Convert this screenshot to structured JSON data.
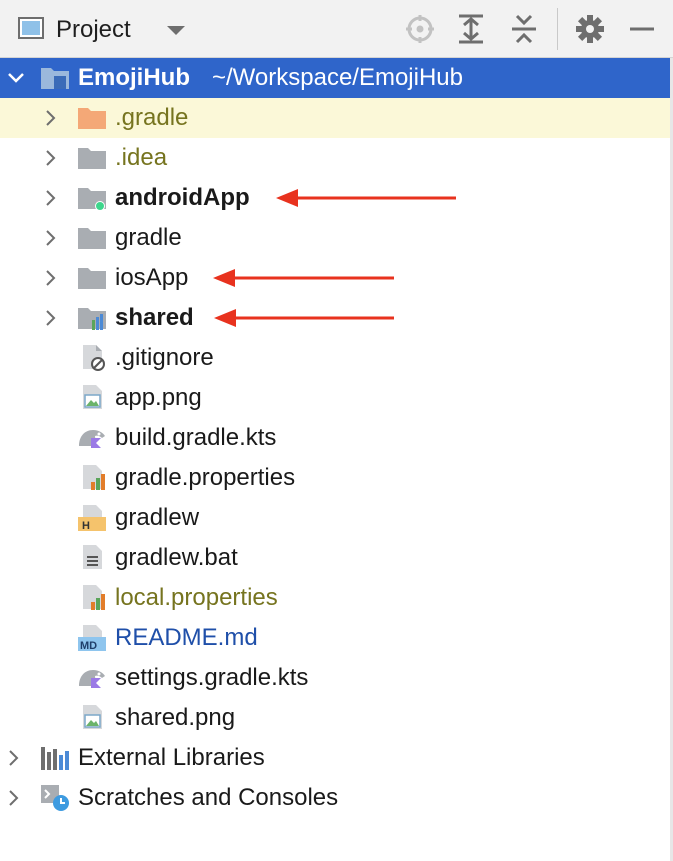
{
  "toolbar": {
    "title": "Project",
    "icons": [
      "project-view-icon",
      "dropdown-chevron-icon",
      "locate-target-icon",
      "expand-all-icon",
      "collapse-all-icon",
      "gear-icon",
      "minimize-icon"
    ]
  },
  "tree": {
    "root": {
      "name": "EmojiHub",
      "path": "~/Workspace/EmojiHub"
    },
    "children": [
      {
        "label": ".gradle",
        "icon": "folder-orange-icon"
      },
      {
        "label": ".idea",
        "icon": "folder-icon"
      },
      {
        "label": "androidApp",
        "icon": "android-module-folder-icon"
      },
      {
        "label": "gradle",
        "icon": "folder-icon"
      },
      {
        "label": "iosApp",
        "icon": "folder-icon"
      },
      {
        "label": "shared",
        "icon": "module-folder-icon"
      },
      {
        "label": ".gitignore",
        "icon": "gitignore-file-icon"
      },
      {
        "label": "app.png",
        "icon": "image-file-icon"
      },
      {
        "label": "build.gradle.kts",
        "icon": "gradle-kotlin-file-icon"
      },
      {
        "label": "gradle.properties",
        "icon": "properties-file-icon"
      },
      {
        "label": "gradlew",
        "icon": "shell-script-file-icon"
      },
      {
        "label": "gradlew.bat",
        "icon": "text-file-icon"
      },
      {
        "label": "local.properties",
        "icon": "properties-file-icon"
      },
      {
        "label": "README.md",
        "icon": "markdown-file-icon"
      },
      {
        "label": "settings.gradle.kts",
        "icon": "gradle-kotlin-file-icon"
      },
      {
        "label": "shared.png",
        "icon": "image-file-icon"
      }
    ],
    "external_libraries": "External Libraries",
    "scratches": "Scratches and Consoles"
  },
  "colors": {
    "selection": "#2f65ca",
    "highlight_row": "#fbf8d8",
    "arrow": "#e8321e",
    "olive_text": "#76741f",
    "blue_text": "#1f4fa9"
  }
}
